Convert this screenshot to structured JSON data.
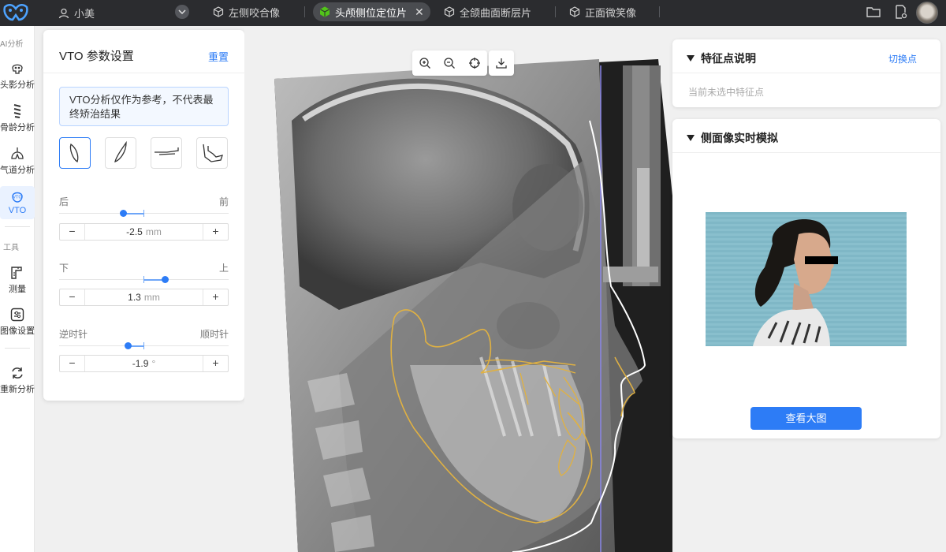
{
  "topbar": {
    "user_name": "小美",
    "tabs": [
      {
        "label": "左侧咬合像",
        "active": false
      },
      {
        "label": "头颅侧位定位片",
        "active": true
      },
      {
        "label": "全颌曲面断层片",
        "active": false
      },
      {
        "label": "正面微笑像",
        "active": false
      }
    ],
    "icons": [
      "folder-icon",
      "document-settings-icon",
      "avatar"
    ]
  },
  "rail": {
    "section_ai": "AI分析",
    "items": [
      {
        "label": "头影分析",
        "icon": "skull-icon"
      },
      {
        "label": "骨龄分析",
        "icon": "spine-icon"
      },
      {
        "label": "气道分析",
        "icon": "airway-icon"
      },
      {
        "label": "VTO",
        "icon": "vto-icon",
        "active": true
      }
    ],
    "section_tools": "工具",
    "tools": [
      {
        "label": "测量",
        "icon": "ruler-icon"
      },
      {
        "label": "图像设置",
        "icon": "image-settings-icon"
      },
      {
        "label": "重新分析",
        "icon": "refresh-icon"
      }
    ]
  },
  "vto": {
    "title": "VTO 参数设置",
    "reset": "重置",
    "note": "VTO分析仅作为参考，不代表最终矫治结果",
    "modes": [
      "upper-incisor-mode-icon",
      "lower-incisor-mode-icon",
      "maxilla-mode-icon",
      "mandible-mode-icon"
    ],
    "params": [
      {
        "left": "后",
        "right": "前",
        "value": "-2.5",
        "unit": "mm",
        "level": 0.375
      },
      {
        "left": "下",
        "right": "上",
        "value": "1.3",
        "unit": "mm",
        "level": 0.625
      },
      {
        "left": "逆时针",
        "right": "顺时针",
        "value": "-1.9",
        "unit": "°",
        "level": 0.405
      }
    ],
    "minus": "−",
    "plus": "+"
  },
  "viewer": {
    "tools": [
      "zoom-in-icon",
      "zoom-out-icon",
      "center-icon"
    ],
    "download": "download-icon"
  },
  "landmark_panel": {
    "title": "特征点说明",
    "link": "切换点",
    "empty": "当前未选中特征点"
  },
  "profile_panel": {
    "title": "侧面像实时模拟",
    "button": "查看大图"
  }
}
